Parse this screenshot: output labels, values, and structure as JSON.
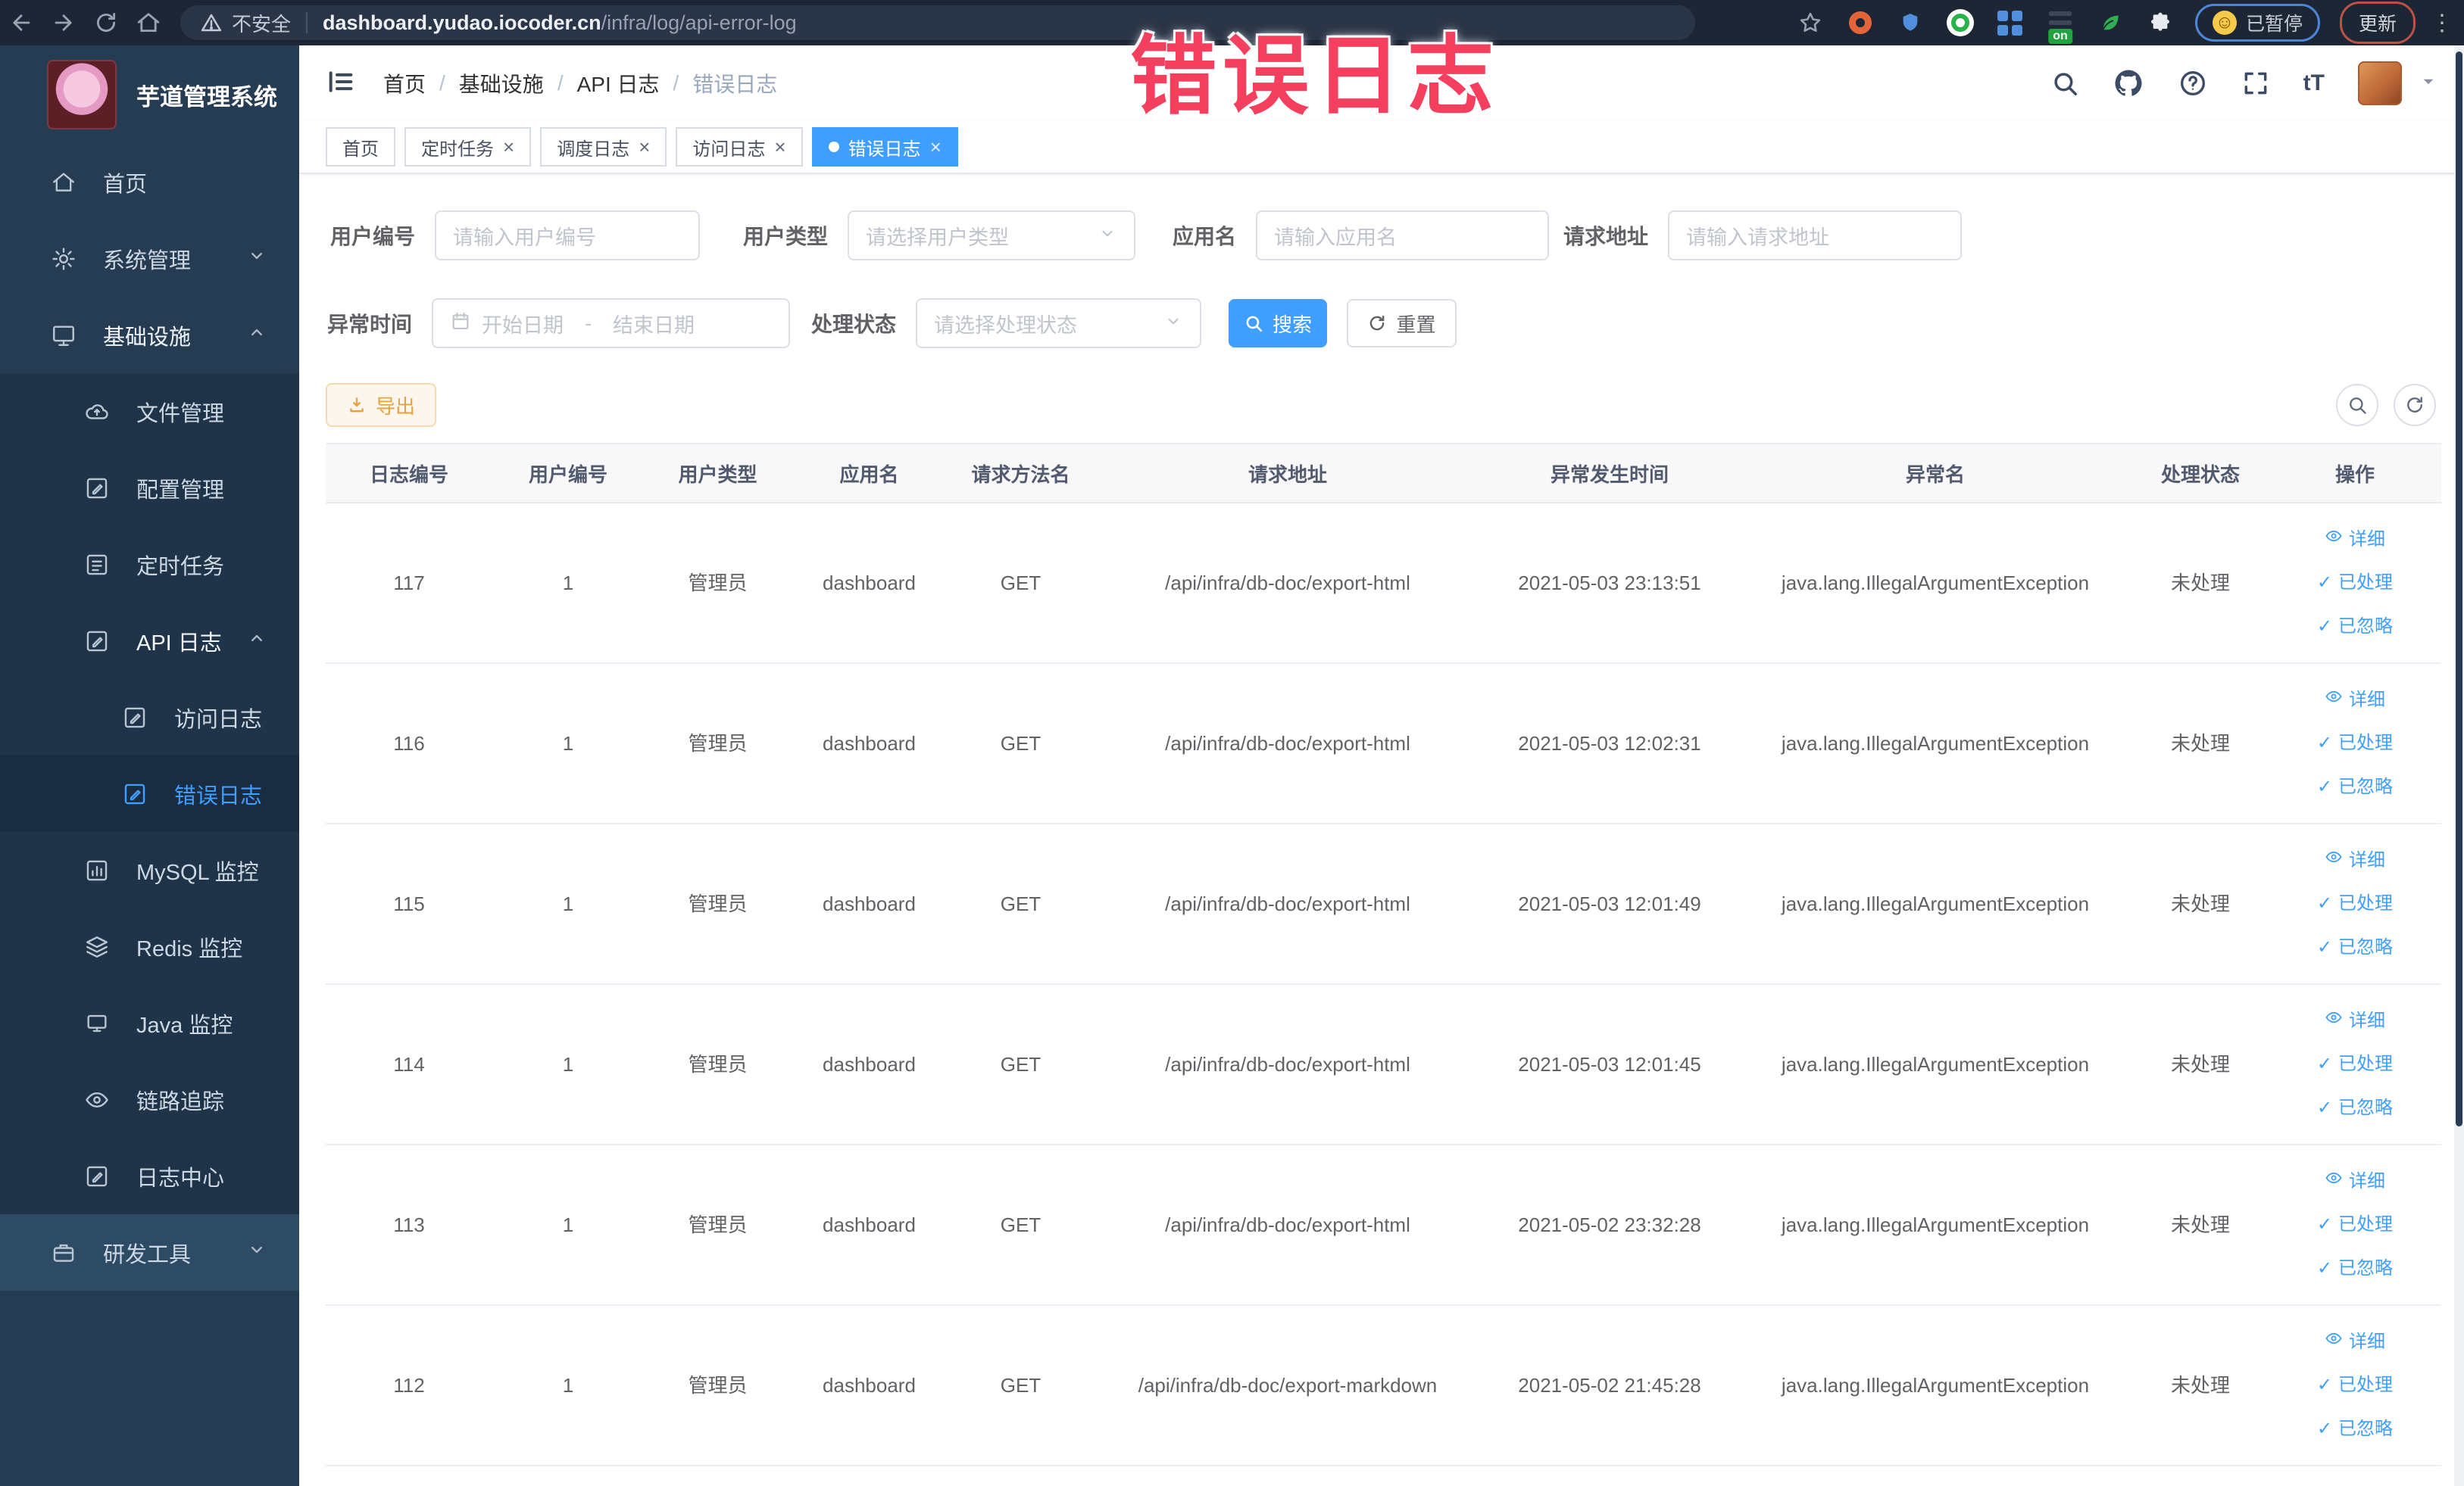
{
  "browser": {
    "security_label": "不安全",
    "url_domain": "dashboard.yudao.iocoder.cn",
    "url_path": "/infra/log/api-error-log",
    "paused_label": "已暂停",
    "update_label": "更新",
    "on_badge": "on"
  },
  "overlay": {
    "text": "错误日志",
    "color": "#f43f5e"
  },
  "sidebar": {
    "title": "芋道管理系统",
    "items": [
      {
        "label": "首页",
        "icon": "home-icon",
        "level": 1
      },
      {
        "label": "系统管理",
        "icon": "gear-icon",
        "level": 1,
        "chevron": "down"
      },
      {
        "label": "基础设施",
        "icon": "monitor-icon",
        "level": 1,
        "chevron": "up",
        "open": true
      },
      {
        "label": "文件管理",
        "icon": "cloud-upload-icon",
        "level": 2
      },
      {
        "label": "配置管理",
        "icon": "edit-square-icon",
        "level": 2
      },
      {
        "label": "定时任务",
        "icon": "task-list-icon",
        "level": 2
      },
      {
        "label": "API 日志",
        "icon": "log-edit-icon",
        "level": 2,
        "chevron": "up",
        "open": true
      },
      {
        "label": "访问日志",
        "icon": "log-edit-icon",
        "level": 3
      },
      {
        "label": "错误日志",
        "icon": "log-edit-icon",
        "level": 3,
        "active": true
      },
      {
        "label": "MySQL 监控",
        "icon": "chart-icon",
        "level": 2
      },
      {
        "label": "Redis 监控",
        "icon": "layers-icon",
        "level": 2
      },
      {
        "label": "Java 监控",
        "icon": "java-monitor-icon",
        "level": 2
      },
      {
        "label": "链路追踪",
        "icon": "eye-icon",
        "level": 2
      },
      {
        "label": "日志中心",
        "icon": "log-edit-icon",
        "level": 2
      },
      {
        "label": "研发工具",
        "icon": "briefcase-icon",
        "level": 1,
        "chevron": "down",
        "highlight": true
      }
    ]
  },
  "header": {
    "breadcrumb": [
      "首页",
      "基础设施",
      "API 日志",
      "错误日志"
    ],
    "separator": "/",
    "fontsize_label": "tT"
  },
  "tabs": [
    {
      "label": "首页",
      "closable": false,
      "active": false
    },
    {
      "label": "定时任务",
      "closable": true,
      "active": false
    },
    {
      "label": "调度日志",
      "closable": true,
      "active": false
    },
    {
      "label": "访问日志",
      "closable": true,
      "active": false
    },
    {
      "label": "错误日志",
      "closable": true,
      "active": true
    }
  ],
  "filters": {
    "user_id_label": "用户编号",
    "user_id_placeholder": "请输入用户编号",
    "user_type_label": "用户类型",
    "user_type_placeholder": "请选择用户类型",
    "app_name_label": "应用名",
    "app_name_placeholder": "请输入应用名",
    "request_url_label": "请求地址",
    "request_url_placeholder": "请输入请求地址",
    "exception_time_label": "异常时间",
    "start_placeholder": "开始日期",
    "range_separator": "-",
    "end_placeholder": "结束日期",
    "process_status_label": "处理状态",
    "process_status_placeholder": "请选择处理状态",
    "search_label": "搜索",
    "reset_label": "重置"
  },
  "toolbar": {
    "export_label": "导出"
  },
  "table": {
    "columns": [
      "日志编号",
      "用户编号",
      "用户类型",
      "应用名",
      "请求方法名",
      "请求地址",
      "异常发生时间",
      "异常名",
      "处理状态",
      "操作"
    ],
    "action_labels": [
      "详细",
      "已处理",
      "已忽略"
    ],
    "rows": [
      {
        "id": "117",
        "user_id": "1",
        "user_type": "管理员",
        "app": "dashboard",
        "method": "GET",
        "url": "/api/infra/db-doc/export-html",
        "time": "2021-05-03 23:13:51",
        "exception": "java.lang.IllegalArgumentException",
        "status": "未处理"
      },
      {
        "id": "116",
        "user_id": "1",
        "user_type": "管理员",
        "app": "dashboard",
        "method": "GET",
        "url": "/api/infra/db-doc/export-html",
        "time": "2021-05-03 12:02:31",
        "exception": "java.lang.IllegalArgumentException",
        "status": "未处理"
      },
      {
        "id": "115",
        "user_id": "1",
        "user_type": "管理员",
        "app": "dashboard",
        "method": "GET",
        "url": "/api/infra/db-doc/export-html",
        "time": "2021-05-03 12:01:49",
        "exception": "java.lang.IllegalArgumentException",
        "status": "未处理"
      },
      {
        "id": "114",
        "user_id": "1",
        "user_type": "管理员",
        "app": "dashboard",
        "method": "GET",
        "url": "/api/infra/db-doc/export-html",
        "time": "2021-05-03 12:01:45",
        "exception": "java.lang.IllegalArgumentException",
        "status": "未处理"
      },
      {
        "id": "113",
        "user_id": "1",
        "user_type": "管理员",
        "app": "dashboard",
        "method": "GET",
        "url": "/api/infra/db-doc/export-html",
        "time": "2021-05-02 23:32:28",
        "exception": "java.lang.IllegalArgumentException",
        "status": "未处理"
      },
      {
        "id": "112",
        "user_id": "1",
        "user_type": "管理员",
        "app": "dashboard",
        "method": "GET",
        "url": "/api/infra/db-doc/export-markdown",
        "time": "2021-05-02 21:45:28",
        "exception": "java.lang.IllegalArgumentException",
        "status": "未处理"
      }
    ]
  },
  "colors": {
    "accent": "#409eff",
    "warning": "#e6a23c",
    "sidebar_bg": "#263c53",
    "chrome_bg": "#1d2634"
  }
}
